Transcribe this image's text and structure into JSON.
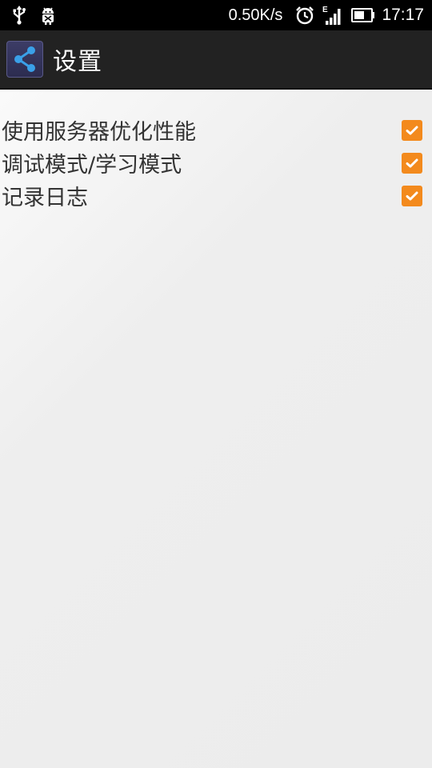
{
  "status_bar": {
    "icons_left": [
      "usb-icon",
      "android-debug-icon"
    ],
    "net_speed": "0.50K/s",
    "icons_right": [
      "alarm-icon",
      "signal-icon",
      "battery-icon"
    ],
    "network_type": "E",
    "time": "17:17"
  },
  "action_bar": {
    "app_icon": "share-icon",
    "title": "设置"
  },
  "settings": [
    {
      "label": "使用服务器优化性能",
      "checked": true
    },
    {
      "label": "调试模式/学习模式",
      "checked": true
    },
    {
      "label": "记录日志",
      "checked": true
    }
  ],
  "colors": {
    "checkbox": "#f38a1d",
    "action_bar": "#222222",
    "status_bar": "#000000",
    "background": "#ececec"
  }
}
